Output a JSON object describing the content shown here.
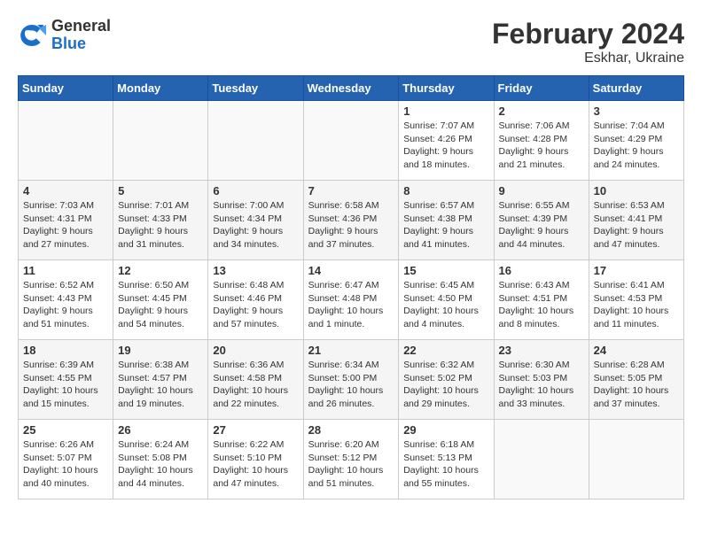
{
  "header": {
    "logo_general": "General",
    "logo_blue": "Blue",
    "title": "February 2024",
    "subtitle": "Eskhar, Ukraine"
  },
  "weekdays": [
    "Sunday",
    "Monday",
    "Tuesday",
    "Wednesday",
    "Thursday",
    "Friday",
    "Saturday"
  ],
  "weeks": [
    [
      {
        "day": "",
        "info": ""
      },
      {
        "day": "",
        "info": ""
      },
      {
        "day": "",
        "info": ""
      },
      {
        "day": "",
        "info": ""
      },
      {
        "day": "1",
        "info": "Sunrise: 7:07 AM\nSunset: 4:26 PM\nDaylight: 9 hours\nand 18 minutes."
      },
      {
        "day": "2",
        "info": "Sunrise: 7:06 AM\nSunset: 4:28 PM\nDaylight: 9 hours\nand 21 minutes."
      },
      {
        "day": "3",
        "info": "Sunrise: 7:04 AM\nSunset: 4:29 PM\nDaylight: 9 hours\nand 24 minutes."
      }
    ],
    [
      {
        "day": "4",
        "info": "Sunrise: 7:03 AM\nSunset: 4:31 PM\nDaylight: 9 hours\nand 27 minutes."
      },
      {
        "day": "5",
        "info": "Sunrise: 7:01 AM\nSunset: 4:33 PM\nDaylight: 9 hours\nand 31 minutes."
      },
      {
        "day": "6",
        "info": "Sunrise: 7:00 AM\nSunset: 4:34 PM\nDaylight: 9 hours\nand 34 minutes."
      },
      {
        "day": "7",
        "info": "Sunrise: 6:58 AM\nSunset: 4:36 PM\nDaylight: 9 hours\nand 37 minutes."
      },
      {
        "day": "8",
        "info": "Sunrise: 6:57 AM\nSunset: 4:38 PM\nDaylight: 9 hours\nand 41 minutes."
      },
      {
        "day": "9",
        "info": "Sunrise: 6:55 AM\nSunset: 4:39 PM\nDaylight: 9 hours\nand 44 minutes."
      },
      {
        "day": "10",
        "info": "Sunrise: 6:53 AM\nSunset: 4:41 PM\nDaylight: 9 hours\nand 47 minutes."
      }
    ],
    [
      {
        "day": "11",
        "info": "Sunrise: 6:52 AM\nSunset: 4:43 PM\nDaylight: 9 hours\nand 51 minutes."
      },
      {
        "day": "12",
        "info": "Sunrise: 6:50 AM\nSunset: 4:45 PM\nDaylight: 9 hours\nand 54 minutes."
      },
      {
        "day": "13",
        "info": "Sunrise: 6:48 AM\nSunset: 4:46 PM\nDaylight: 9 hours\nand 57 minutes."
      },
      {
        "day": "14",
        "info": "Sunrise: 6:47 AM\nSunset: 4:48 PM\nDaylight: 10 hours\nand 1 minute."
      },
      {
        "day": "15",
        "info": "Sunrise: 6:45 AM\nSunset: 4:50 PM\nDaylight: 10 hours\nand 4 minutes."
      },
      {
        "day": "16",
        "info": "Sunrise: 6:43 AM\nSunset: 4:51 PM\nDaylight: 10 hours\nand 8 minutes."
      },
      {
        "day": "17",
        "info": "Sunrise: 6:41 AM\nSunset: 4:53 PM\nDaylight: 10 hours\nand 11 minutes."
      }
    ],
    [
      {
        "day": "18",
        "info": "Sunrise: 6:39 AM\nSunset: 4:55 PM\nDaylight: 10 hours\nand 15 minutes."
      },
      {
        "day": "19",
        "info": "Sunrise: 6:38 AM\nSunset: 4:57 PM\nDaylight: 10 hours\nand 19 minutes."
      },
      {
        "day": "20",
        "info": "Sunrise: 6:36 AM\nSunset: 4:58 PM\nDaylight: 10 hours\nand 22 minutes."
      },
      {
        "day": "21",
        "info": "Sunrise: 6:34 AM\nSunset: 5:00 PM\nDaylight: 10 hours\nand 26 minutes."
      },
      {
        "day": "22",
        "info": "Sunrise: 6:32 AM\nSunset: 5:02 PM\nDaylight: 10 hours\nand 29 minutes."
      },
      {
        "day": "23",
        "info": "Sunrise: 6:30 AM\nSunset: 5:03 PM\nDaylight: 10 hours\nand 33 minutes."
      },
      {
        "day": "24",
        "info": "Sunrise: 6:28 AM\nSunset: 5:05 PM\nDaylight: 10 hours\nand 37 minutes."
      }
    ],
    [
      {
        "day": "25",
        "info": "Sunrise: 6:26 AM\nSunset: 5:07 PM\nDaylight: 10 hours\nand 40 minutes."
      },
      {
        "day": "26",
        "info": "Sunrise: 6:24 AM\nSunset: 5:08 PM\nDaylight: 10 hours\nand 44 minutes."
      },
      {
        "day": "27",
        "info": "Sunrise: 6:22 AM\nSunset: 5:10 PM\nDaylight: 10 hours\nand 47 minutes."
      },
      {
        "day": "28",
        "info": "Sunrise: 6:20 AM\nSunset: 5:12 PM\nDaylight: 10 hours\nand 51 minutes."
      },
      {
        "day": "29",
        "info": "Sunrise: 6:18 AM\nSunset: 5:13 PM\nDaylight: 10 hours\nand 55 minutes."
      },
      {
        "day": "",
        "info": ""
      },
      {
        "day": "",
        "info": ""
      }
    ]
  ]
}
